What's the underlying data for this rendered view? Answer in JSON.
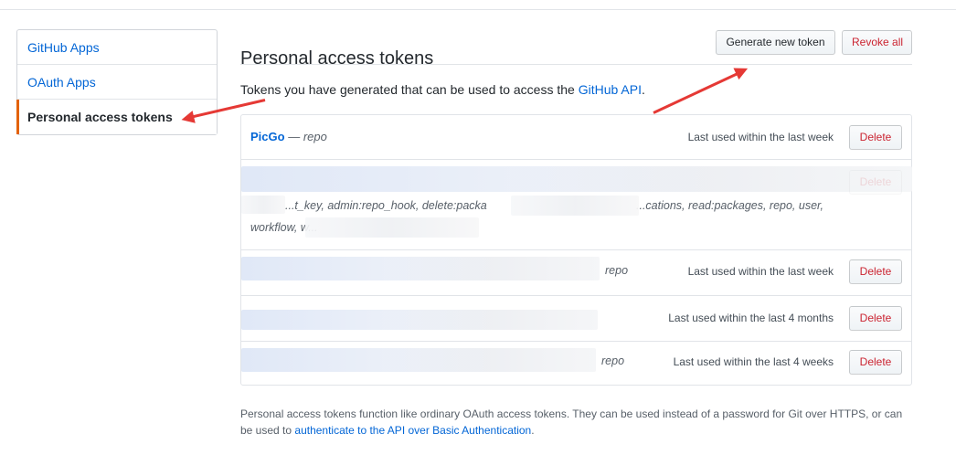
{
  "sidebar": {
    "items": [
      {
        "label": "GitHub Apps"
      },
      {
        "label": "OAuth Apps"
      },
      {
        "label": "Personal access tokens"
      }
    ]
  },
  "main": {
    "title": "Personal access tokens",
    "generate_label": "Generate new token",
    "revoke_label": "Revoke all",
    "intro_text": "Tokens you have generated that can be used to access the ",
    "intro_link": "GitHub API",
    "intro_end": ".",
    "tokens": [
      {
        "name": "PicGo",
        "sep": " — ",
        "scopes": "repo",
        "last_used": "Last used within the last week",
        "delete": "Delete"
      },
      {
        "name": "",
        "scopes_part1": "...t_key, admin:repo_hook, delete:packa",
        "scopes_part2": "...cations, read:packages, repo, user,",
        "scopes_part3": "workflow, w...",
        "last_used": "",
        "delete": "Delete"
      },
      {
        "name": "",
        "scopes": "repo",
        "last_used": "Last used within the last week",
        "delete": "Delete"
      },
      {
        "name": "",
        "scopes": "",
        "last_used": "Last used within the last 4 months",
        "delete": "Delete"
      },
      {
        "name": "",
        "scopes": "repo",
        "last_used": "Last used within the last 4 weeks",
        "delete": "Delete"
      }
    ],
    "footer_text": "Personal access tokens function like ordinary OAuth access tokens. They can be used instead of a password for Git over HTTPS, or can be used to ",
    "footer_link": "authenticate to the API over Basic Authentication",
    "footer_end": "."
  },
  "colors": {
    "accent": "#0366d6",
    "danger": "#cb2431",
    "selected_marker": "#e36209",
    "annotation_arrow": "#e53935"
  }
}
